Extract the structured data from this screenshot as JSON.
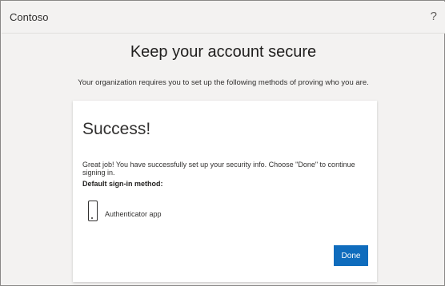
{
  "header": {
    "brand": "Contoso",
    "help_glyph": "?"
  },
  "page": {
    "title": "Keep your account secure",
    "subtitle": "Your organization requires you to set up the following methods of proving who you are."
  },
  "card": {
    "title": "Success!",
    "message": "Great job! You have successfully set up your security info. Choose \"Done\" to continue signing in.",
    "default_label": "Default sign-in method:",
    "method_icon": "phone-icon",
    "method_name": "Authenticator app",
    "done_label": "Done"
  },
  "colors": {
    "accent": "#0f6cbd",
    "background": "#f3f2f1",
    "card": "#ffffff"
  }
}
